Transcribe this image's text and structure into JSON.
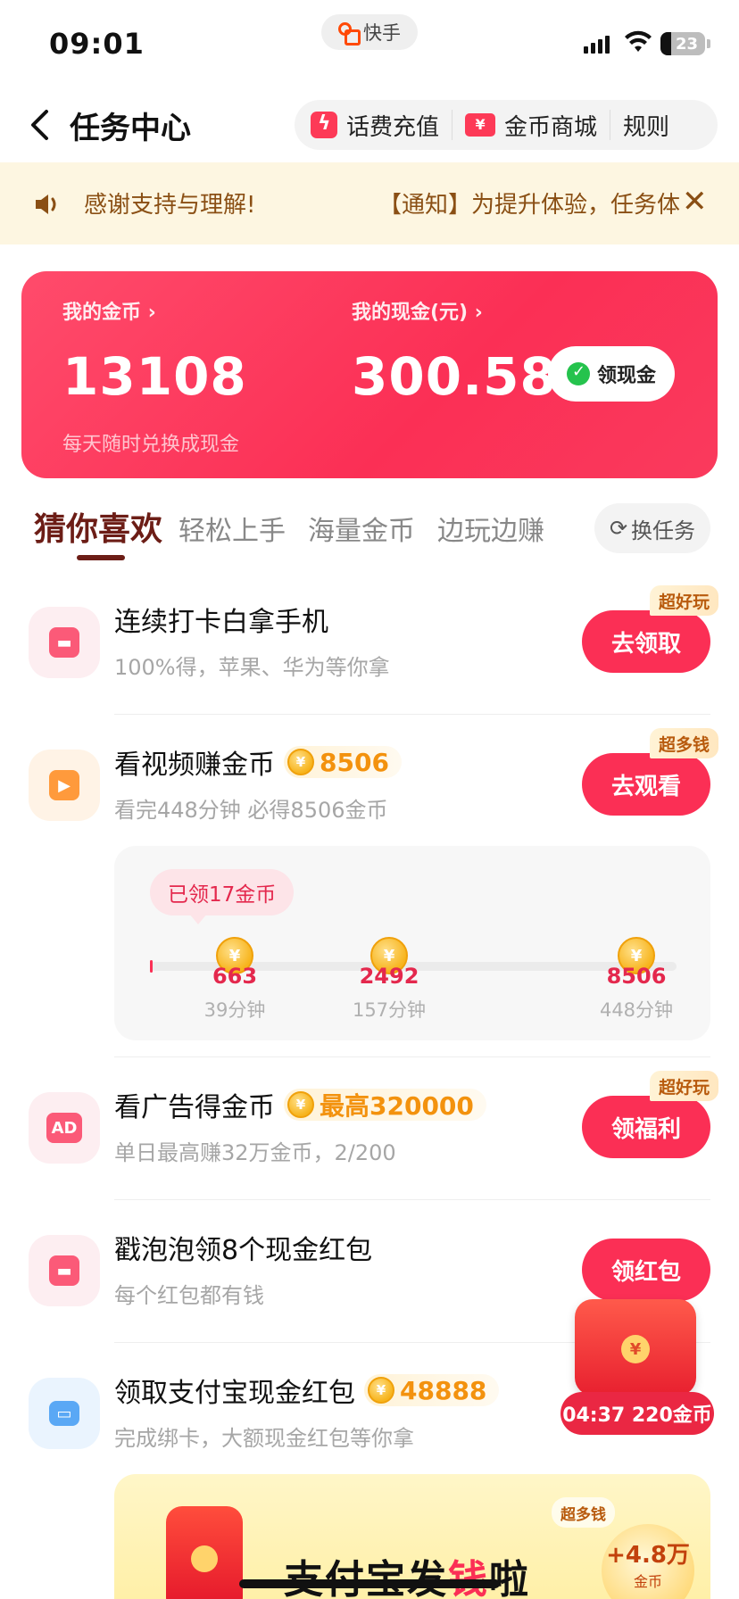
{
  "status_bar": {
    "time": "09:01",
    "app_name": "快手",
    "battery": "23"
  },
  "header": {
    "title": "任务中心",
    "actions": [
      {
        "label": "话费充值",
        "icon": "lightning-icon"
      },
      {
        "label": "金币商城",
        "icon": "ticket-icon"
      },
      {
        "label": "规则"
      }
    ]
  },
  "notice": {
    "thanks": "感谢支持与理解!",
    "message": "【通知】为提升体验，任务体"
  },
  "wallet": {
    "coins_label": "我的金币",
    "coins_value": "13108",
    "coins_sub": "每天随时兑换成现金",
    "cash_label": "我的现金(元)",
    "cash_value": "300.58",
    "cash_button": "领现金"
  },
  "tabs": {
    "items": [
      "猜你喜欢",
      "轻松上手",
      "海量金币",
      "边玩边赚"
    ],
    "active": "猜你喜欢",
    "swap_button": "换任务"
  },
  "tasks": [
    {
      "title": "连续打卡白拿手机",
      "sub": "100%得，苹果、华为等你拿",
      "button": "去领取",
      "badge": "超好玩",
      "icon": "redpack-icon",
      "icon_color": "#fb5a78"
    },
    {
      "title": "看视频赚金币",
      "coin": "8506",
      "sub": "看完448分钟 必得8506金币",
      "button": "去观看",
      "badge": "超多钱",
      "icon": "video-camera-icon",
      "icon_color": "#ff9a3c"
    },
    {
      "title": "看广告得金币",
      "coin": "最高320000",
      "sub": "单日最高赚32万金币，2/200",
      "button": "领福利",
      "badge": "超好玩",
      "icon": "ad-icon",
      "icon_color": "#fb5a78"
    },
    {
      "title": "戳泡泡领8个现金红包",
      "sub": "每个红包都有钱",
      "button": "领红包",
      "icon": "redpack-icon",
      "icon_color": "#fb5a78"
    },
    {
      "title": "领取支付宝现金红包",
      "coin": "48888",
      "sub": "完成绑卡，大额现金红包等你拿",
      "icon": "card-icon",
      "icon_color": "#5aa8f5"
    }
  ],
  "video_progress": {
    "received": "已领17金币",
    "progress_fraction": 0.0,
    "milestones": [
      {
        "coins": "663",
        "time": "39分钟"
      },
      {
        "coins": "2492",
        "time": "157分钟"
      },
      {
        "coins": "8506",
        "time": "448分钟"
      }
    ]
  },
  "floating": {
    "timer": "04:37 220金币"
  },
  "banner": {
    "title_pre": "支付宝发",
    "title_hl": "钱",
    "title_post": "啦",
    "tag": "超多钱",
    "prize_amount": "+4.8万",
    "prize_unit": "金币"
  },
  "colors": {
    "accent": "#fb2f55",
    "notice_bg": "#fdf6e1",
    "notice_text": "#8a4f14",
    "coin": "#f3920e"
  }
}
